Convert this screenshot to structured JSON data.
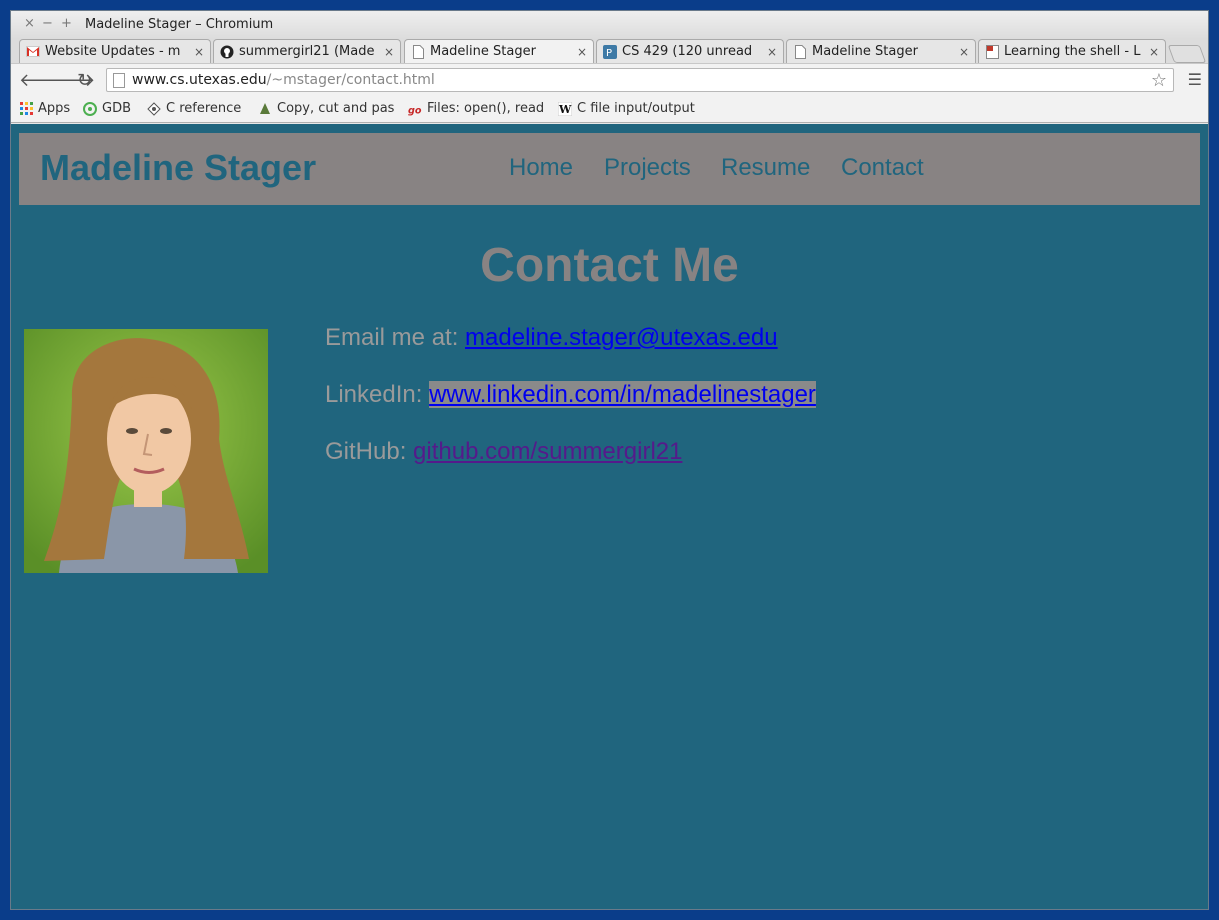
{
  "window": {
    "title": "Madeline Stager – Chromium",
    "controls": [
      "×",
      "−",
      "+"
    ]
  },
  "tabs": [
    {
      "label": "Website Updates - m",
      "icon": "gmail-icon",
      "active": false
    },
    {
      "label": "summergirl21 (Made",
      "icon": "github-icon",
      "active": false
    },
    {
      "label": "Madeline Stager",
      "icon": "page-icon",
      "active": true
    },
    {
      "label": "CS 429 (120 unread",
      "icon": "piazza-icon",
      "active": false
    },
    {
      "label": "Madeline Stager",
      "icon": "page-icon",
      "active": false
    },
    {
      "label": "Learning the shell - L",
      "icon": "doc-icon",
      "active": false
    }
  ],
  "tab_close": "×",
  "address_bar": {
    "host": "www.cs.utexas.edu",
    "path": "/~mstager/contact.html"
  },
  "bookmarks": [
    {
      "label": "Apps",
      "icon": "apps-grid-icon"
    },
    {
      "label": "GDB",
      "icon": "gdb-icon"
    },
    {
      "label": "C reference",
      "icon": "c-reference-icon"
    },
    {
      "label": "Copy, cut and pas",
      "icon": "bookmark-icon"
    },
    {
      "label": "Files: open(), read",
      "icon": "gnu-icon"
    },
    {
      "label": "C file input/output",
      "icon": "wikipedia-icon"
    }
  ],
  "site": {
    "brand": "Madeline Stager",
    "nav": [
      "Home",
      "Projects",
      "Resume",
      "Contact"
    ],
    "heading": "Contact Me",
    "contacts": [
      {
        "label": "Email me at: ",
        "link": "madeline.stager@utexas.edu"
      },
      {
        "label": "LinkedIn: ",
        "link": "www.linkedin.com/in/madelinestager"
      },
      {
        "label": "GitHub: ",
        "link": "github.com/summergirl21"
      }
    ]
  },
  "colors": {
    "page_bg": "#20657e",
    "header_bg": "#888383",
    "link": "#0000ee",
    "visited_link": "#551a8b"
  }
}
